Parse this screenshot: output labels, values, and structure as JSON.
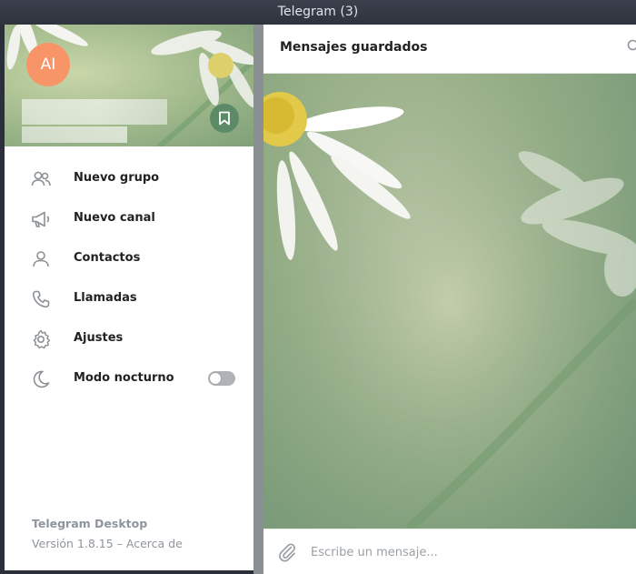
{
  "window": {
    "title": "Telegram (3)"
  },
  "drawer": {
    "avatar_initials": "AI",
    "avatar_color": "#f79468",
    "menu": [
      {
        "label": "Nuevo grupo",
        "icon": "group-icon"
      },
      {
        "label": "Nuevo canal",
        "icon": "megaphone-icon"
      },
      {
        "label": "Contactos",
        "icon": "person-icon"
      },
      {
        "label": "Llamadas",
        "icon": "phone-icon"
      },
      {
        "label": "Ajustes",
        "icon": "gear-icon"
      },
      {
        "label": "Modo nocturno",
        "icon": "moon-icon",
        "toggle": false
      }
    ],
    "footer": {
      "app_name": "Telegram Desktop",
      "version_text": "Versión 1.8.15 – ",
      "about_link": "Acerca de"
    }
  },
  "chat": {
    "title": "Mensajes guardados",
    "composer_placeholder": "Escribe un mensaje..."
  },
  "colors": {
    "accent_green": "#5c8a67",
    "titlebar": "#2f333d"
  }
}
